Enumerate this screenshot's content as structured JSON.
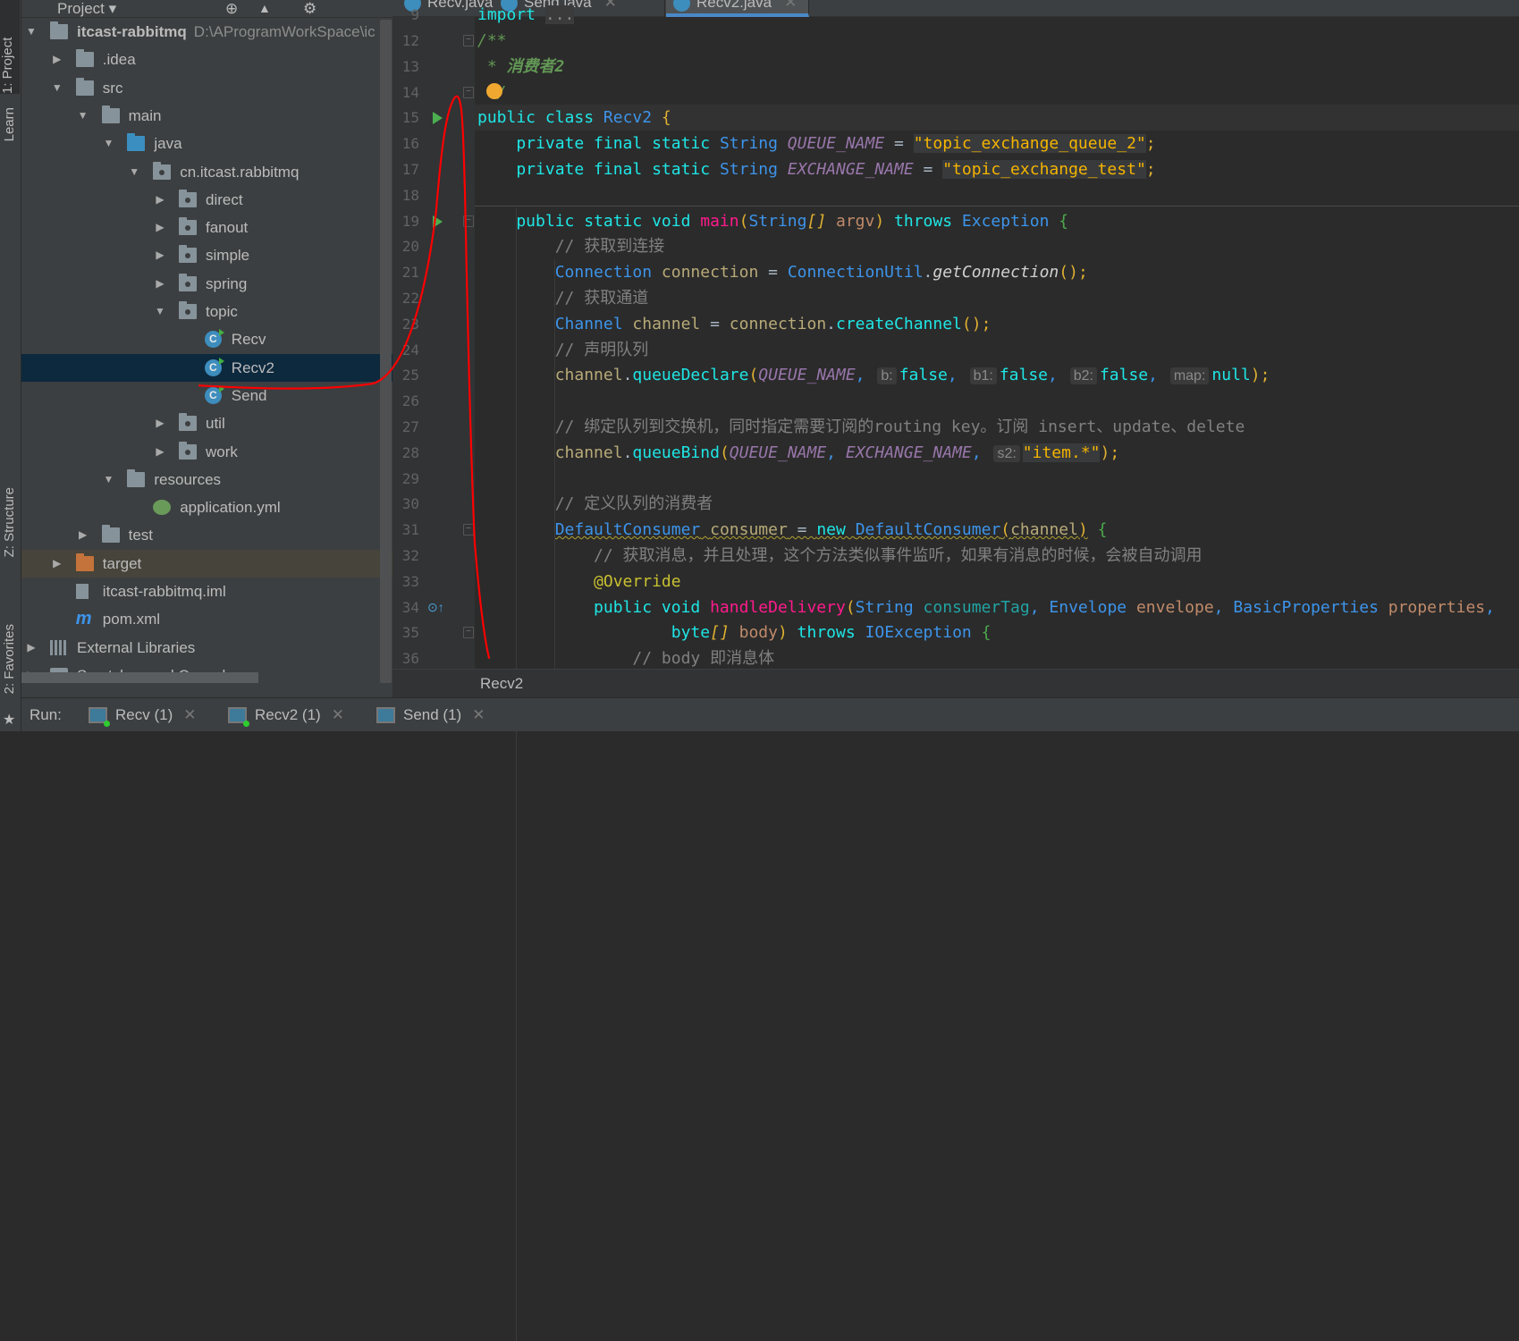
{
  "sidebar_strip": {
    "items": [
      "1: Project",
      "Learn",
      "Z: Structure",
      "2: Favorites"
    ]
  },
  "project_panel": {
    "title": "Project",
    "tree": [
      {
        "level": 0,
        "arrow": "open",
        "icon": "module",
        "label": "itcast-rabbitmq",
        "path": "D:\\AProgramWorkSpace\\ic"
      },
      {
        "level": 1,
        "arrow": "closed",
        "icon": "folder",
        "label": ".idea"
      },
      {
        "level": 1,
        "arrow": "open",
        "icon": "folder",
        "label": "src"
      },
      {
        "level": 2,
        "arrow": "open",
        "icon": "folder",
        "label": "main"
      },
      {
        "level": 3,
        "arrow": "open",
        "icon": "folder-blue",
        "label": "java"
      },
      {
        "level": 4,
        "arrow": "open",
        "icon": "package",
        "label": "cn.itcast.rabbitmq"
      },
      {
        "level": 5,
        "arrow": "closed",
        "icon": "package",
        "label": "direct"
      },
      {
        "level": 5,
        "arrow": "closed",
        "icon": "package",
        "label": "fanout"
      },
      {
        "level": 5,
        "arrow": "closed",
        "icon": "package",
        "label": "simple"
      },
      {
        "level": 5,
        "arrow": "closed",
        "icon": "package",
        "label": "spring"
      },
      {
        "level": 5,
        "arrow": "open",
        "icon": "package",
        "label": "topic"
      },
      {
        "level": 6,
        "arrow": "none",
        "icon": "class",
        "label": "Recv"
      },
      {
        "level": 6,
        "arrow": "none",
        "icon": "class",
        "label": "Recv2",
        "selected": true
      },
      {
        "level": 6,
        "arrow": "none",
        "icon": "class",
        "label": "Send"
      },
      {
        "level": 5,
        "arrow": "closed",
        "icon": "package",
        "label": "util"
      },
      {
        "level": 5,
        "arrow": "closed",
        "icon": "package",
        "label": "work"
      },
      {
        "level": 3,
        "arrow": "open",
        "icon": "resources",
        "label": "resources"
      },
      {
        "level": 4,
        "arrow": "none",
        "icon": "spring-yml",
        "label": "application.yml"
      },
      {
        "level": 2,
        "arrow": "closed",
        "icon": "folder",
        "label": "test"
      },
      {
        "level": 1,
        "arrow": "closed",
        "icon": "folder-orange",
        "label": "target",
        "excluded": true
      },
      {
        "level": 1,
        "arrow": "none",
        "icon": "iml",
        "label": "itcast-rabbitmq.iml"
      },
      {
        "level": 1,
        "arrow": "none",
        "icon": "maven",
        "label": "pom.xml"
      },
      {
        "level": 0,
        "arrow": "closed",
        "icon": "libraries",
        "label": "External Libraries"
      },
      {
        "level": 0,
        "arrow": "closed",
        "icon": "scratches",
        "label": "Scratches and Consoles"
      }
    ]
  },
  "editor": {
    "tabs": [
      {
        "label": "Recv.java",
        "active": false
      },
      {
        "label": "Send.java",
        "active": false
      },
      {
        "label": "Recv2.java",
        "active": true
      }
    ],
    "current_line": 15,
    "lines": [
      {
        "n": "9",
        "t": [
          [
            "import ",
            "kw"
          ],
          [
            "...",
            "fold"
          ]
        ]
      },
      {
        "n": "12",
        "t": [
          [
            "/**",
            "doc"
          ]
        ]
      },
      {
        "n": "13",
        "t": [
          [
            " * ",
            "doc"
          ],
          [
            "消费者2",
            "docb"
          ]
        ]
      },
      {
        "n": "14",
        "t": [
          [
            "  /",
            "doc"
          ]
        ]
      },
      {
        "n": "15",
        "t": [
          [
            "public class ",
            "kw"
          ],
          [
            "Recv2",
            "ty"
          ],
          [
            " {",
            "br"
          ]
        ]
      },
      {
        "n": "16",
        "t": [
          [
            "    private final static ",
            "kw"
          ],
          [
            "String ",
            "ty"
          ],
          [
            "QUEUE_NAME",
            "cst"
          ],
          [
            " = ",
            "pl"
          ],
          [
            "\"topic_exchange_queue_2\"",
            "str"
          ],
          [
            ";",
            "br"
          ]
        ]
      },
      {
        "n": "17",
        "t": [
          [
            "    private final static ",
            "kw"
          ],
          [
            "String ",
            "ty"
          ],
          [
            "EXCHANGE_NAME",
            "cst"
          ],
          [
            " = ",
            "pl"
          ],
          [
            "\"topic_exchange_test\"",
            "str"
          ],
          [
            ";",
            "br"
          ]
        ]
      },
      {
        "n": "18",
        "t": []
      },
      {
        "n": "19",
        "t": [
          [
            "    public static void ",
            "kw"
          ],
          [
            "main",
            "fn"
          ],
          [
            "(",
            "br"
          ],
          [
            "String",
            "ty"
          ],
          [
            "[]",
            "brit"
          ],
          [
            " argv",
            "par"
          ],
          [
            ")",
            "br"
          ],
          [
            " throws ",
            "kw"
          ],
          [
            "Exception ",
            "ty"
          ],
          [
            "{",
            "grn"
          ]
        ]
      },
      {
        "n": "20",
        "t": [
          [
            "        // 获取到连接",
            "cm"
          ]
        ]
      },
      {
        "n": "21",
        "t": [
          [
            "        ",
            "pl"
          ],
          [
            "Connection ",
            "ty"
          ],
          [
            "connection",
            "var"
          ],
          [
            " = ",
            "pl"
          ],
          [
            "ConnectionUtil",
            "ty"
          ],
          [
            ".",
            "pl"
          ],
          [
            "getConnection",
            "it"
          ],
          [
            "();",
            "br"
          ]
        ]
      },
      {
        "n": "22",
        "t": [
          [
            "        // 获取通道",
            "cm"
          ]
        ]
      },
      {
        "n": "23",
        "t": [
          [
            "        ",
            "pl"
          ],
          [
            "Channel ",
            "ty"
          ],
          [
            "channel",
            "var"
          ],
          [
            " = ",
            "pl"
          ],
          [
            "connection",
            "var"
          ],
          [
            ".",
            "pl"
          ],
          [
            "createChannel",
            "kw"
          ],
          [
            "();",
            "br"
          ]
        ]
      },
      {
        "n": "24",
        "t": [
          [
            "        // 声明队列",
            "cm"
          ]
        ]
      },
      {
        "n": "25",
        "t": [
          [
            "        ",
            "pl"
          ],
          [
            "channel",
            "var"
          ],
          [
            ".",
            "pl"
          ],
          [
            "queueDeclare",
            "kw"
          ],
          [
            "(",
            "br"
          ],
          [
            "QUEUE_NAME",
            "cst"
          ],
          [
            ", ",
            "ty"
          ],
          [
            "b:",
            "hint"
          ],
          [
            "false",
            "kw"
          ],
          [
            ", ",
            "ty"
          ],
          [
            "b1:",
            "hint"
          ],
          [
            "false",
            "kw"
          ],
          [
            ", ",
            "ty"
          ],
          [
            "b2:",
            "hint"
          ],
          [
            "false",
            "kw"
          ],
          [
            ", ",
            "ty"
          ],
          [
            "map:",
            "hint"
          ],
          [
            "null",
            "kw"
          ],
          [
            ");",
            "br"
          ]
        ]
      },
      {
        "n": "26",
        "t": []
      },
      {
        "n": "27",
        "t": [
          [
            "        // 绑定队列到交换机，同时指定需要订阅的routing key。订阅 insert、update、delete",
            "cm"
          ]
        ]
      },
      {
        "n": "28",
        "t": [
          [
            "        ",
            "pl"
          ],
          [
            "channel",
            "var"
          ],
          [
            ".",
            "pl"
          ],
          [
            "queueBind",
            "kw"
          ],
          [
            "(",
            "br"
          ],
          [
            "QUEUE_NAME",
            "cst"
          ],
          [
            ", ",
            "ty"
          ],
          [
            "EXCHANGE_NAME",
            "cst"
          ],
          [
            ", ",
            "ty"
          ],
          [
            "s2:",
            "hint"
          ],
          [
            "\"item.*\"",
            "str"
          ],
          [
            ");",
            "br"
          ]
        ]
      },
      {
        "n": "29",
        "t": []
      },
      {
        "n": "30",
        "t": [
          [
            "        // 定义队列的消费者",
            "cm"
          ]
        ]
      },
      {
        "n": "31",
        "t": [
          [
            "        ",
            "pl"
          ],
          [
            "DefaultConsumer",
            "ty wv"
          ],
          [
            " ",
            "pl wv"
          ],
          [
            "consumer",
            "var wv"
          ],
          [
            " = ",
            "pl wv"
          ],
          [
            "new ",
            "kw wv"
          ],
          [
            "DefaultConsumer",
            "ty wv"
          ],
          [
            "(",
            "br wv"
          ],
          [
            "channel",
            "var wv"
          ],
          [
            ")",
            "br wv"
          ],
          [
            " {",
            "grn"
          ]
        ]
      },
      {
        "n": "32",
        "t": [
          [
            "            // 获取消息，并且处理，这个方法类似事件监听，如果有消息的时候，会被自动调用",
            "cm"
          ]
        ]
      },
      {
        "n": "33",
        "t": [
          [
            "            ",
            "pl"
          ],
          [
            "@Override",
            "ann"
          ]
        ]
      },
      {
        "n": "34",
        "t": [
          [
            "            ",
            "pl"
          ],
          [
            "public void ",
            "kw"
          ],
          [
            "handleDelivery",
            "fn"
          ],
          [
            "(",
            "br"
          ],
          [
            "String ",
            "ty"
          ],
          [
            "consumerTag",
            "teal"
          ],
          [
            ", ",
            "ty"
          ],
          [
            "Envelope ",
            "ty"
          ],
          [
            "envelope",
            "par"
          ],
          [
            ", ",
            "ty"
          ],
          [
            "BasicProperties ",
            "ty"
          ],
          [
            "properties",
            "par"
          ],
          [
            ",",
            "ty"
          ]
        ]
      },
      {
        "n": "35",
        "t": [
          [
            "                    ",
            "pl"
          ],
          [
            "byte",
            "kw"
          ],
          [
            "[]",
            "brit"
          ],
          [
            " body",
            "par"
          ],
          [
            ")",
            "br"
          ],
          [
            " throws ",
            "kw"
          ],
          [
            "IOException ",
            "ty"
          ],
          [
            "{",
            "grn"
          ]
        ]
      },
      {
        "n": "36",
        "t": [
          [
            "                // body 即消息体",
            "cm"
          ]
        ]
      }
    ],
    "breadcrumb": "Recv2"
  },
  "run_bar": {
    "label": "Run:",
    "tabs": [
      {
        "label": "Recv (1)",
        "running": true
      },
      {
        "label": "Recv2 (1)",
        "running": true
      },
      {
        "label": "Send (1)",
        "running": false
      }
    ]
  },
  "annotation_color": "#ff0000"
}
